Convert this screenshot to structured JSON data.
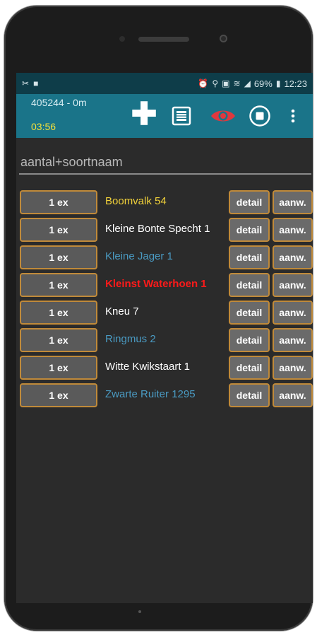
{
  "statusbar": {
    "battery_percent": "69%",
    "time": "12:23"
  },
  "appbar": {
    "count_info": "405244 - 0m",
    "timer": "03:56"
  },
  "search": {
    "placeholder": "aantal+soortnaam"
  },
  "colors": {
    "appbar": "#1a7489",
    "statusbar": "#0e3d49",
    "accent_border": "#c08a3a",
    "eye_icon": "#e0383e",
    "timer": "#f2e03a"
  },
  "species": [
    {
      "count": "1 ex",
      "name": "Boomvalk 54",
      "color": "#f2d23a",
      "bold": false,
      "detail": "detail",
      "aanw": "aanw."
    },
    {
      "count": "1 ex",
      "name": "Kleine Bonte Specht 1",
      "color": "#ffffff",
      "bold": false,
      "detail": "detail",
      "aanw": "aanw."
    },
    {
      "count": "1 ex",
      "name": "Kleine Jager 1",
      "color": "#4a9ac2",
      "bold": false,
      "detail": "detail",
      "aanw": "aanw."
    },
    {
      "count": "1 ex",
      "name": "Kleinst Waterhoen 1",
      "color": "#ff1a1a",
      "bold": true,
      "detail": "detail",
      "aanw": "aanw."
    },
    {
      "count": "1 ex",
      "name": "Kneu 7",
      "color": "#ffffff",
      "bold": false,
      "detail": "detail",
      "aanw": "aanw."
    },
    {
      "count": "1 ex",
      "name": "Ringmus 2",
      "color": "#4a9ac2",
      "bold": false,
      "detail": "detail",
      "aanw": "aanw."
    },
    {
      "count": "1 ex",
      "name": "Witte Kwikstaart 1",
      "color": "#ffffff",
      "bold": false,
      "detail": "detail",
      "aanw": "aanw."
    },
    {
      "count": "1 ex",
      "name": "Zwarte Ruiter 1295",
      "color": "#4a9ac2",
      "bold": false,
      "detail": "detail",
      "aanw": "aanw."
    }
  ],
  "icons": [
    "add-icon",
    "list-icon",
    "eye-icon",
    "stop-icon",
    "more-vert-icon"
  ]
}
